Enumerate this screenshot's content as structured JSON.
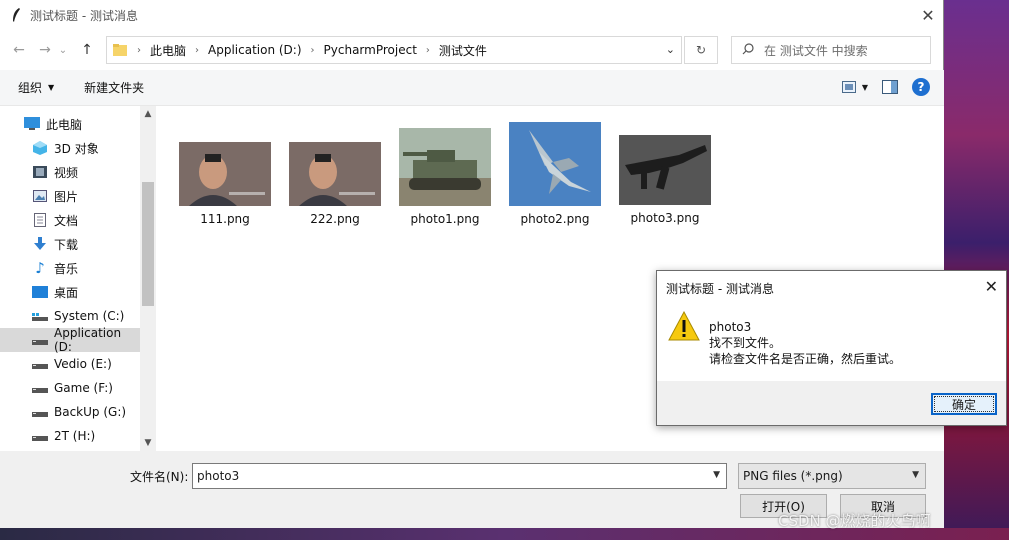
{
  "window": {
    "title": "测试标题 - 测试消息",
    "close_glyph": "✕"
  },
  "nav": {
    "back": "←",
    "forward": "→",
    "recent": "⌄",
    "up": "↑",
    "breadcrumbs": [
      "此电脑",
      "Application (D:)",
      "PycharmProject",
      "测试文件"
    ],
    "refresh": "↻",
    "search_placeholder": "在 测试文件 中搜索"
  },
  "toolbar": {
    "organize": "组织",
    "new_folder": "新建文件夹",
    "help": "?"
  },
  "sidebar": {
    "items": [
      {
        "label": "此电脑",
        "icon": "computer-icon"
      },
      {
        "label": "3D 对象",
        "icon": "cube-icon"
      },
      {
        "label": "视频",
        "icon": "video-icon"
      },
      {
        "label": "图片",
        "icon": "picture-icon"
      },
      {
        "label": "文档",
        "icon": "document-icon"
      },
      {
        "label": "下载",
        "icon": "download-icon"
      },
      {
        "label": "音乐",
        "icon": "music-icon"
      },
      {
        "label": "桌面",
        "icon": "desktop-icon"
      },
      {
        "label": "System (C:)",
        "icon": "drive-icon"
      },
      {
        "label": "Application (D:",
        "icon": "drive-icon",
        "selected": true
      },
      {
        "label": "Vedio (E:)",
        "icon": "drive-icon"
      },
      {
        "label": "Game (F:)",
        "icon": "drive-icon"
      },
      {
        "label": "BackUp (G:)",
        "icon": "drive-icon"
      },
      {
        "label": "2T (H:)",
        "icon": "drive-icon"
      }
    ]
  },
  "files": [
    {
      "name": "111.png",
      "thumb": "portrait"
    },
    {
      "name": "222.png",
      "thumb": "portrait"
    },
    {
      "name": "photo1.png",
      "thumb": "tank"
    },
    {
      "name": "photo2.png",
      "thumb": "jet"
    },
    {
      "name": "photo3.png",
      "thumb": "rifle"
    }
  ],
  "bottom": {
    "filename_label": "文件名(N):",
    "filename_value": "photo3",
    "filetype": "PNG files (*.png)",
    "open": "打开(O)",
    "cancel": "取消"
  },
  "message": {
    "title": "测试标题 - 测试消息",
    "line1": "photo3",
    "line2": "找不到文件。",
    "line3": "请检查文件名是否正确，然后重试。",
    "ok": "确定",
    "close_glyph": "✕"
  },
  "watermark": "CSDN @燃烧的火鸟啊"
}
